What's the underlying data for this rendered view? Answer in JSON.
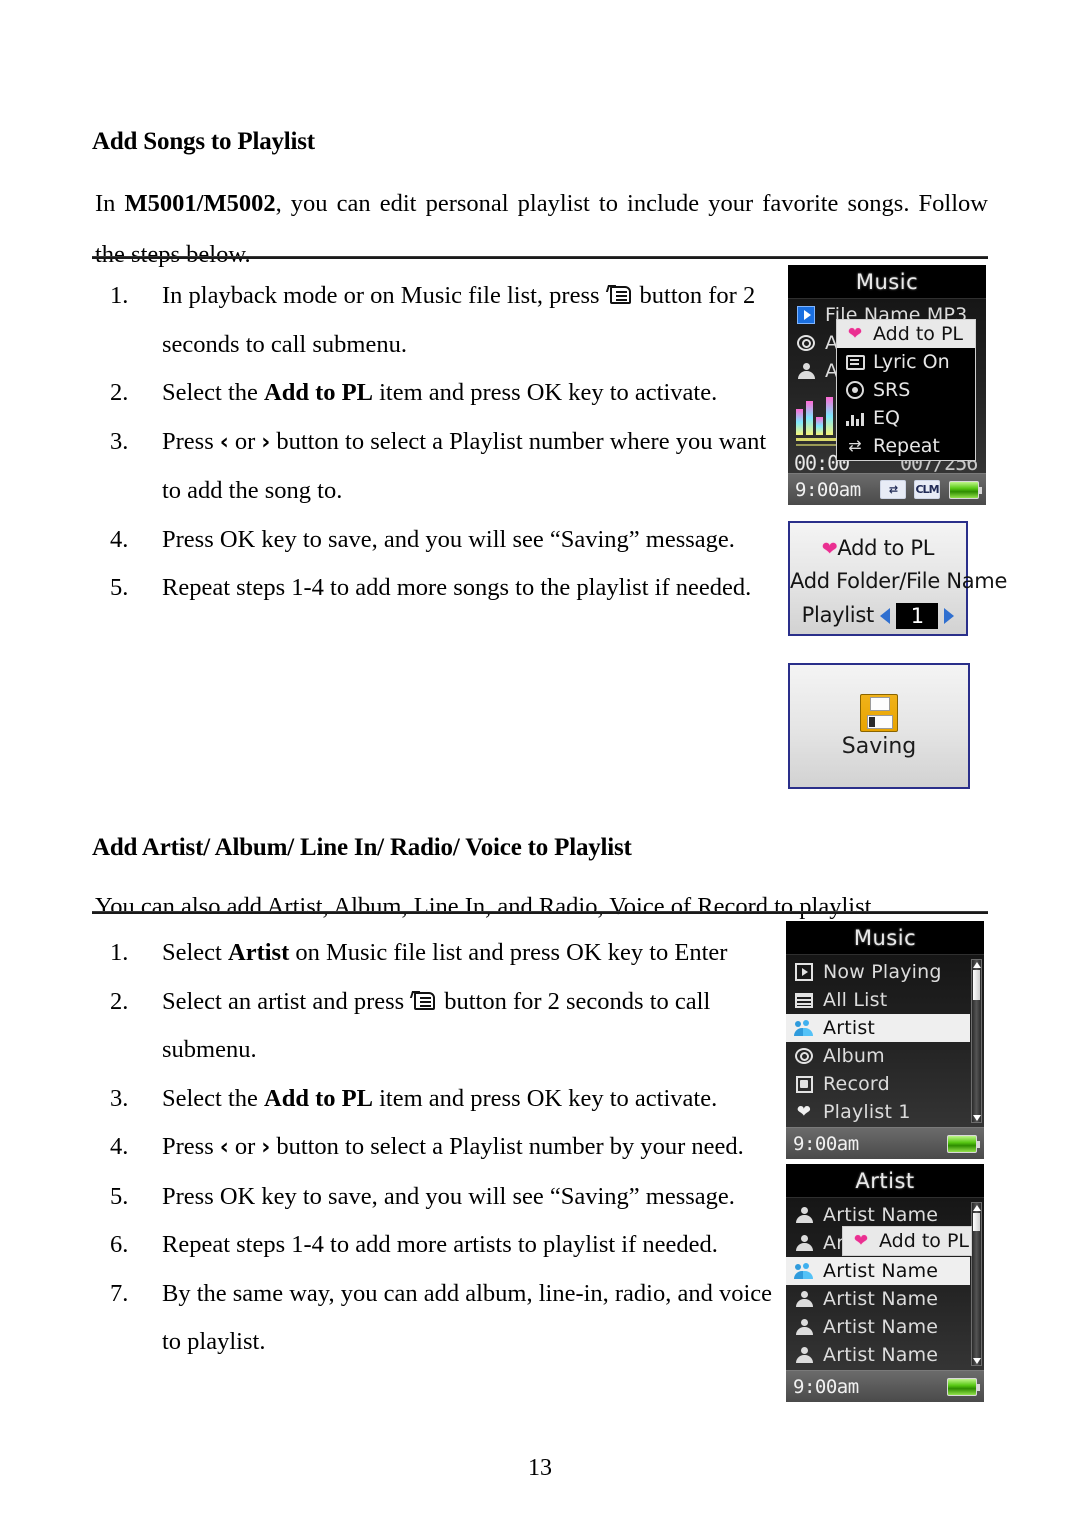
{
  "document": {
    "page_number": "13"
  },
  "section1": {
    "heading": "Add Songs to Playlist",
    "intro_pre": "In ",
    "intro_bold": "M5001/M5002",
    "intro_post": ", you can edit personal playlist to include your favorite songs. Follow the steps below.",
    "steps": [
      {
        "num": "1.",
        "pre": "In playback mode or on Music file list, press",
        "icon": "menu-icon",
        "post": "button for 2 seconds to call submenu."
      },
      {
        "num": "2.",
        "pre": "Select the",
        "bold": "Add to PL",
        "post": "item and press OK key to activate."
      },
      {
        "num": "3.",
        "pre": "Press",
        "left_glyph": "‹",
        "mid": "or",
        "right_glyph": "›",
        "post": "button to select a Playlist number where you want to add the song to."
      },
      {
        "num": "4.",
        "text": "Press OK key to save, and you will see “Saving” message."
      },
      {
        "num": "5.",
        "text": "Repeat steps 1-4 to add more songs to the playlist if needed."
      }
    ]
  },
  "section2": {
    "heading": "Add Artist/ Album/ Line In/ Radio/ Voice to Playlist",
    "intro": "You can also add Artist, Album, Line In, and Radio, Voice of Record to playlist.",
    "steps": [
      {
        "num": "1.",
        "pre": "Select",
        "bold": "Artist",
        "post": "on Music file list and press OK key to Enter"
      },
      {
        "num": "2.",
        "pre": "Select an artist and press",
        "icon": "menu-icon",
        "post": "button for 2 seconds to call submenu."
      },
      {
        "num": "3.",
        "pre": "Select the",
        "bold": "Add to PL",
        "post": "item and press OK key to activate."
      },
      {
        "num": "4.",
        "pre": "Press",
        "left_glyph": "‹",
        "mid": "or",
        "right_glyph": "›",
        "post": "button to select a Playlist number by your need."
      },
      {
        "num": "5.",
        "text": "Press OK key to save, and you will see “Saving” message."
      },
      {
        "num": "6.",
        "text": "Repeat steps 1-4 to add more artists to playlist if needed."
      },
      {
        "num": "7.",
        "text": "By the same way, you can add album, line-in, radio, and voice to playlist."
      }
    ]
  },
  "screens": {
    "music_playback": {
      "title": "Music",
      "rows": [
        {
          "label": "File Name MP3",
          "icon": "play-blue-icon"
        },
        {
          "label": "Al",
          "icon": "album-icon"
        },
        {
          "label": "Ar",
          "icon": "person-icon"
        }
      ],
      "time_elapsed": "00:00",
      "time_total": "007/256",
      "submenu": [
        {
          "label": "Add to PL",
          "icon": "heart-pink-icon",
          "selected": true
        },
        {
          "label": "Lyric On",
          "icon": "lyric-icon",
          "selected": false
        },
        {
          "label": "SRS",
          "icon": "srs-icon",
          "selected": false
        },
        {
          "label": "EQ",
          "icon": "eq-icon",
          "selected": false
        },
        {
          "label": "Repeat",
          "icon": "repeat-icon",
          "selected": false
        }
      ],
      "status": {
        "clock": "9:00am",
        "icon1": "repeat-icon",
        "icon2": "CLM",
        "battery": "battery-full-icon"
      }
    },
    "add_to_pl_dialog": {
      "title": "Add to PL",
      "subtitle": "Add Folder/File Name",
      "field_label": "Playlist",
      "field_value": "1",
      "left_arrow": "arrow-left-icon",
      "right_arrow": "arrow-right-icon"
    },
    "saving_dialog": {
      "icon": "floppy-save-icon",
      "label": "Saving"
    },
    "music_list": {
      "title": "Music",
      "rows": [
        {
          "label": "Now Playing",
          "icon": "play-box-icon",
          "selected": false
        },
        {
          "label": "All List",
          "icon": "list-icon",
          "selected": false
        },
        {
          "label": "Artist",
          "icon": "group-blue-icon",
          "selected": true
        },
        {
          "label": "Album",
          "icon": "album-icon",
          "selected": false
        },
        {
          "label": "Record",
          "icon": "record-icon",
          "selected": false
        },
        {
          "label": "Playlist 1",
          "icon": "heart-white-icon",
          "selected": false
        }
      ],
      "status": {
        "clock": "9:00am",
        "battery": "battery-full-icon"
      }
    },
    "artist_list": {
      "title": "Artist",
      "rows": [
        {
          "label": "Artist Name",
          "icon": "person-icon",
          "selected": false
        },
        {
          "label": "Ar",
          "icon": "person-icon",
          "selected": false
        },
        {
          "label": "Artist Name",
          "icon": "group-blue-icon",
          "selected": true
        },
        {
          "label": "Artist Name",
          "icon": "person-icon",
          "selected": false
        },
        {
          "label": "Artist Name",
          "icon": "person-icon",
          "selected": false
        },
        {
          "label": "Artist Name",
          "icon": "person-icon",
          "selected": false
        }
      ],
      "popup": {
        "label": "Add to PL",
        "icon": "heart-pink-icon"
      },
      "status": {
        "clock": "9:00am",
        "battery": "battery-full-icon"
      }
    }
  }
}
